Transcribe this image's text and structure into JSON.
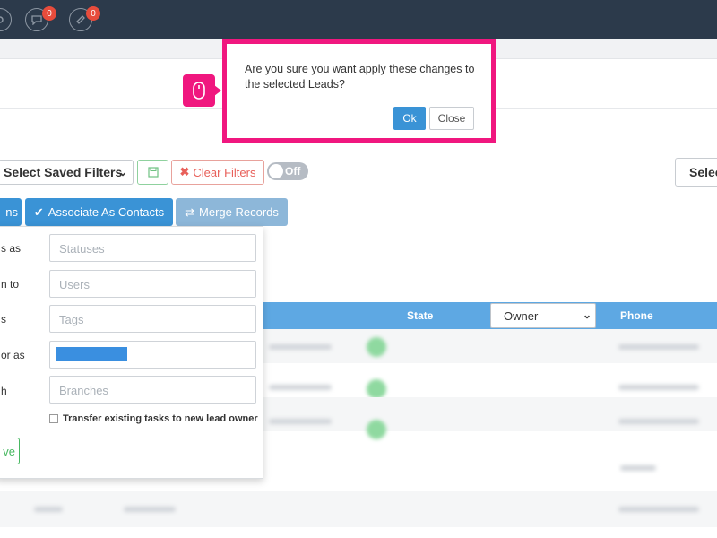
{
  "topbar": {
    "icons": [
      {
        "name": "settings-icon",
        "badge": null
      },
      {
        "name": "chat-icon",
        "badge": "0"
      },
      {
        "name": "ticket-icon",
        "badge": "0"
      }
    ]
  },
  "filters": {
    "saved_filters_label": "Select Saved Filters",
    "clear_filters_label": "Clear Filters",
    "toggle_label": "Off",
    "right_select_label": "Selec"
  },
  "actions": {
    "actions_partial_label": "ns",
    "associate_label": "Associate As Contacts",
    "merge_label": "Merge Records"
  },
  "panel": {
    "fields": [
      {
        "label": "s as",
        "placeholder": "Statuses"
      },
      {
        "label": "n to",
        "placeholder": "Users"
      },
      {
        "label": "s",
        "placeholder": "Tags"
      },
      {
        "label": "or as",
        "placeholder": ""
      },
      {
        "label": "h",
        "placeholder": "Branches"
      }
    ],
    "transfer_label": "Transfer existing tasks to new lead owner",
    "save_partial_label": "ve"
  },
  "table": {
    "state_header": "State",
    "owner_select": "Owner",
    "phone_header": "Phone"
  },
  "modal": {
    "message": "Are you sure you want apply these changes to the selected Leads?",
    "ok_label": "Ok",
    "close_label": "Close"
  },
  "colors": {
    "topbar": "#2c3a4b",
    "primary": "#3a93d6",
    "table_header": "#5ea8e3",
    "danger": "#e8605a",
    "success": "#49b862",
    "highlight": "#f0177f"
  }
}
